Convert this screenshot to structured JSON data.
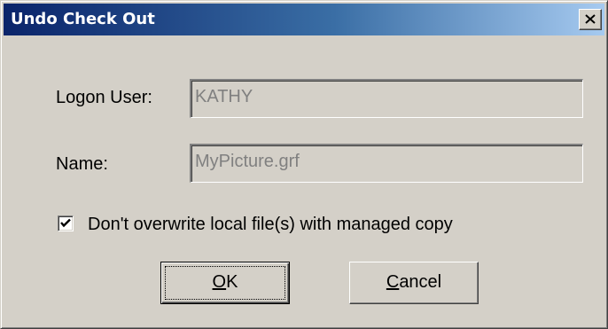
{
  "window": {
    "title": "Undo Check Out",
    "close_icon": "close-x-icon"
  },
  "form": {
    "logon_user": {
      "label": "Logon User:",
      "value": "KATHY"
    },
    "name": {
      "label": "Name:",
      "value": "MyPicture.grf"
    },
    "keep_local_checkbox": {
      "label": "Don't overwrite local file(s) with managed copy",
      "checked": true
    }
  },
  "buttons": {
    "ok": {
      "mnemonic": "O",
      "rest": "K"
    },
    "cancel": {
      "mnemonic": "C",
      "rest": "ancel"
    }
  },
  "colors": {
    "titlebar_start": "#0a246a",
    "titlebar_end": "#a6caf0",
    "face": "#d4d0c8",
    "disabled_text": "#808080"
  }
}
